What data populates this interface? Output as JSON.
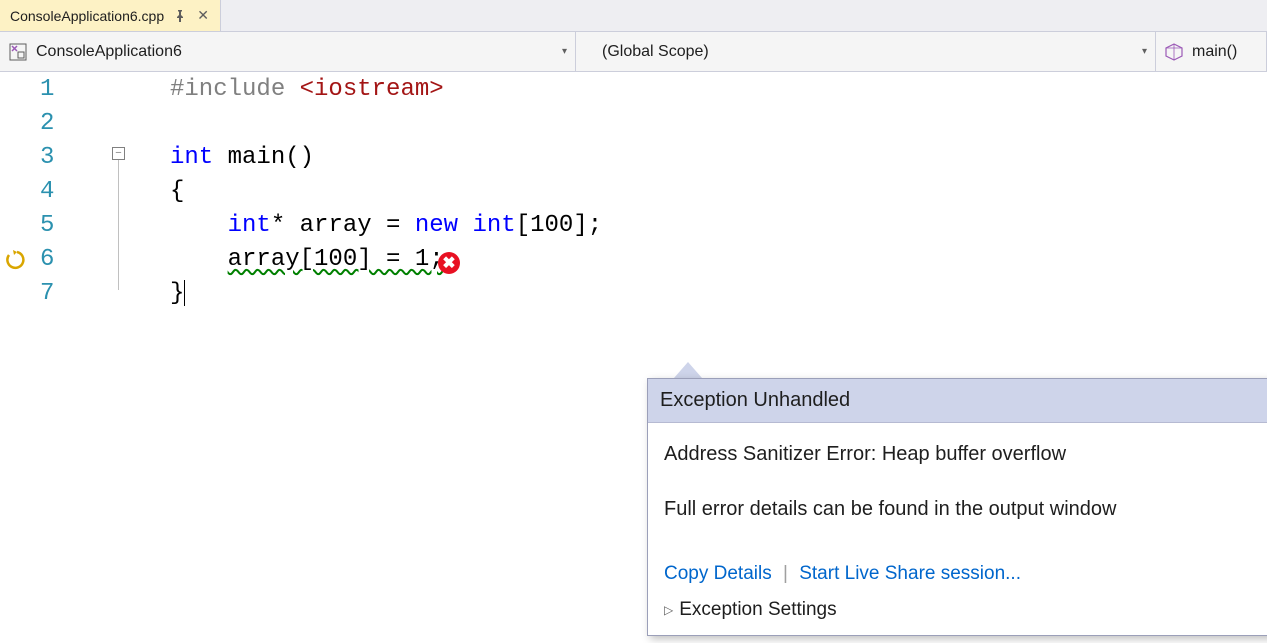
{
  "tab": {
    "filename": "ConsoleApplication6.cpp"
  },
  "nav": {
    "project": "ConsoleApplication6",
    "scope": "(Global Scope)",
    "func": "main()"
  },
  "code": {
    "lines": [
      "1",
      "2",
      "3",
      "4",
      "5",
      "6",
      "7"
    ],
    "include_kw": "#include ",
    "include_hdr": "<iostream>",
    "int_kw": "int",
    "main_sig": " main()",
    "brace_open": "{",
    "l5_a": "int",
    "l5_b": "* array = ",
    "l5_c": "new",
    "l5_d": " ",
    "l5_e": "int",
    "l5_f": "[100];",
    "l6": "array[100] = 1;",
    "brace_close": "}"
  },
  "popup": {
    "title": "Exception Unhandled",
    "msg1": "Address Sanitizer Error: Heap buffer overflow",
    "msg2": "Full error details can be found in the output window",
    "link_copy": "Copy Details",
    "link_live": "Start Live Share session...",
    "exc_settings": "Exception Settings"
  }
}
